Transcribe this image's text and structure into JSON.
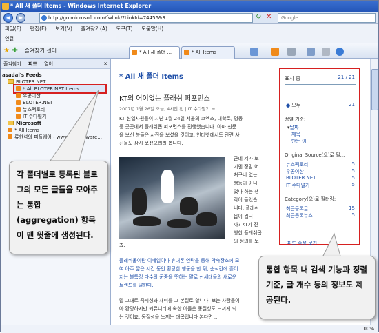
{
  "window": {
    "title": "* All 새 폴더 Items - Windows Internet Explorer",
    "url": "http://go.microsoft.com/fwlink/?LinkId=74456&3",
    "search_placeholder": "Google"
  },
  "menu": [
    "파일(F)",
    "편집(E)",
    "보기(V)",
    "즐겨찾기(A)",
    "도구(T)",
    "도움말(H)"
  ],
  "links_bar": "연결",
  "toolbar": {
    "favorites_label": "즐겨찾기 센터",
    "tabs": [
      "* All 새 폴더 ...",
      "* All Items"
    ]
  },
  "pane": {
    "tabs": [
      "즐겨찾기",
      "피드",
      "열어..."
    ],
    "tree": [
      {
        "label": "asadal's Feeds",
        "type": "root"
      },
      {
        "label": "BLOTER.NET",
        "type": "folder"
      },
      {
        "label": "* All BLOTER.NET Items",
        "type": "feed",
        "highlight": true
      },
      {
        "label": "우공이산",
        "type": "feed"
      },
      {
        "label": "BLOTER.NET",
        "type": "feed"
      },
      {
        "label": "뉴스팩토리",
        "type": "feed"
      },
      {
        "label": "IT 수다떨기",
        "type": "feed"
      },
      {
        "label": "Microsoft",
        "type": "folder"
      },
      {
        "label": "* All Items",
        "type": "feed"
      },
      {
        "label": "류한석의 피플웨어 - www.peopleware...",
        "type": "feed"
      }
    ]
  },
  "content": {
    "feed_title": "* All 새 폴더 Items",
    "post_title": "KT의 어이없는 플래쉬 퍼포먼스",
    "post_meta": "2007년 1월 26일 오늘, 4시간 전 | IT 수다떨기 ➔",
    "para1": [
      "KT 신입사원들이 지난 1월 24일 서울의 코엑스, 대학로, 명동",
      "등 곳곳에서 플래쉬몹 퍼포먼스를 진행했습니다. 아마 신문",
      "을 보신 분들은 사진을 보셨을 것이고, 인터넷에서도 관련 사",
      "진들도 잠시 보셨으리라 봅니다."
    ],
    "para2": [
      "근데 제가 보",
      "기엔 정말 어",
      "처구니 없는",
      "행동이 아니",
      "었나 하는 생",
      "각이 들었습",
      "니다. 플래쉬",
      "몹이 뭡니",
      "까? KT가 진",
      "행한 플래쉬몹",
      "의 정의를 보"
    ],
    "para2_end": "죠.",
    "para3": [
      "플래쉬몹이란 이메일이나 휴대폰 연락을 통해 약속장소에 모",
      "여 아주 짧은 시간 동안 황당한 행동을 한 뒤, 순식간에 흩어",
      "지는 불특정 다수의 군중을 뜻하는 말로 신세대들의 새로운",
      "트렌드를 말한다."
    ],
    "para4": [
      "말 그대로 즉시성과 재미를 그 본질로 합니다. 보는 사람들이",
      "아 황당하지만 커뮤니티에 속한 이들은 동질성도 느끼게 되",
      "는 것이죠. 동질성을 느끼는 대목입니다 본다면 ..."
    ]
  },
  "sidepanel": {
    "display_label": "표시 중",
    "display_count": "21 / 21",
    "all_label": "모두",
    "all_count": "21",
    "sort_label": "정렬 기준:",
    "sort_options": [
      "날짜",
      "제목",
      "만든 이"
    ],
    "source_label": "Original Source(으)로 필...",
    "sources": [
      {
        "name": "뉴스팩토리",
        "count": "5"
      },
      {
        "name": "우공이산",
        "count": "5"
      },
      {
        "name": "BLOTER.NET",
        "count": "5"
      },
      {
        "name": "IT 수다떨기",
        "count": "5"
      }
    ],
    "category_label": "Category(으)로 필터링:",
    "categories": [
      {
        "name": "최근등록글",
        "count": "15"
      },
      {
        "name": "최근등록뉴스",
        "count": "5"
      }
    ],
    "footer_link": "피드 속성 보기"
  },
  "status": {
    "zoom": "100%"
  },
  "callouts": {
    "left": "각 폴더별로 등록된 블로그의 모든 글들을 모아주는 통합 (aggregation) 항목이 맨 윗줄에 생성된다.",
    "right": "통합 항목 내 검색 기능과 정렬 기준, 글 개수 등의 정보도 제공된다."
  },
  "colors": {
    "accent": "#1f4fa8",
    "highlight_border": "#d62020"
  }
}
